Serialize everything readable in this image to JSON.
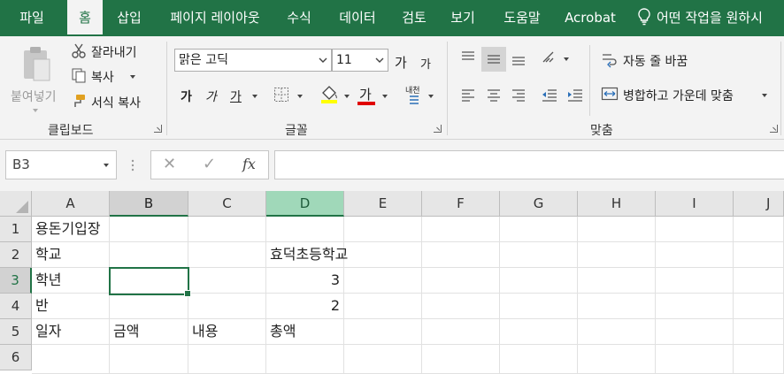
{
  "tabs": [
    {
      "label": "파일",
      "active": false
    },
    {
      "label": "홈",
      "active": true
    },
    {
      "label": "삽입",
      "active": false
    },
    {
      "label": "페이지 레이아웃",
      "active": false
    },
    {
      "label": "수식",
      "active": false
    },
    {
      "label": "데이터",
      "active": false
    },
    {
      "label": "검토",
      "active": false
    },
    {
      "label": "보기",
      "active": false
    },
    {
      "label": "도움말",
      "active": false
    },
    {
      "label": "Acrobat",
      "active": false
    }
  ],
  "tell_me": "어떤 작업을 원하시",
  "clipboard": {
    "paste": "붙여넣기",
    "cut": "잘라내기",
    "copy": "복사",
    "format_painter": "서식 복사",
    "group_label": "클립보드"
  },
  "font": {
    "name": "맑은 고딕",
    "size": "11",
    "grow": "가",
    "shrink": "가",
    "bold": "가",
    "italic": "가",
    "underline": "가",
    "font_color_glyph": "가",
    "phonetic": "내천",
    "group_label": "글꼴"
  },
  "alignment": {
    "wrap_text": "자동 줄 바꿈",
    "merge_center": "병합하고 가운데 맞춤",
    "group_label": "맞춤"
  },
  "formula_bar": {
    "name_box": "B3",
    "cancel": "✕",
    "enter": "✓",
    "fx": "fx",
    "formula": ""
  },
  "grid": {
    "columns": [
      "A",
      "B",
      "C",
      "D",
      "E",
      "F",
      "G",
      "H",
      "I",
      "J"
    ],
    "rows": [
      "1",
      "2",
      "3",
      "4",
      "5",
      "6"
    ],
    "cells": {
      "A1": "용돈기입장",
      "A2": "학교",
      "D2": "효덕초등학교",
      "A3": "학년",
      "D3": "3",
      "A4": "반",
      "D4": "2",
      "A5": "일자",
      "B5": "금액",
      "C5": "내용",
      "D5": "총액"
    },
    "active_cell": "B3"
  },
  "colors": {
    "accent": "#217346",
    "fill_highlight": "#ffff00",
    "font_color": "#e00000"
  }
}
